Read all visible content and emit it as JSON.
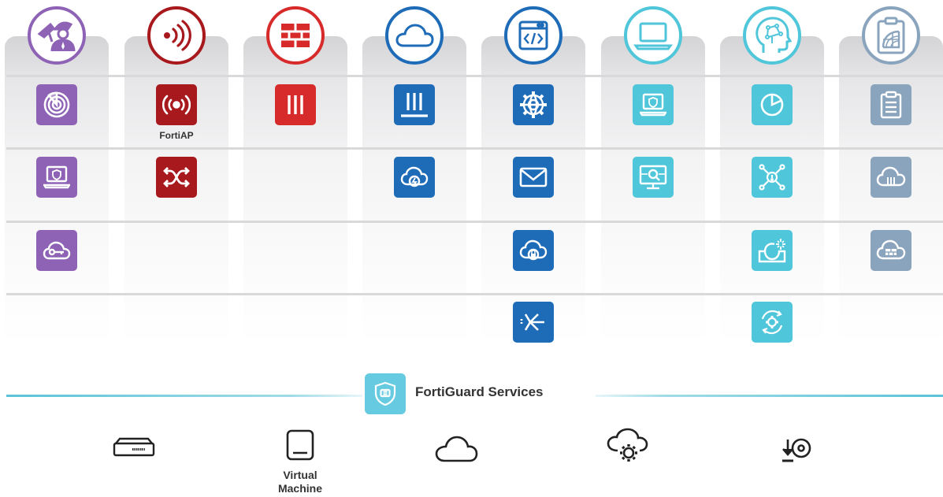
{
  "colors": {
    "purple": "#8e63b5",
    "dark_red": "#a8191e",
    "red": "#d72b2b",
    "blue": "#1e6bb8",
    "teal": "#4fc6d9",
    "gray_blue": "#8aa4bd",
    "fortiguard": "#66cbe0"
  },
  "columns": [
    {
      "header_icon": "security-guard-icon",
      "color": "#8e63b5",
      "tiles": [
        "radar-icon",
        "laptop-shield-icon",
        "key-cloud-icon",
        null
      ]
    },
    {
      "header_icon": "wireless-signal-icon",
      "color": "#a8191e",
      "tiles": [
        "wireless-ap-icon",
        "switch-arrows-icon",
        null,
        null
      ]
    },
    {
      "header_icon": "firewall-brick-icon",
      "color": "#d72b2b",
      "tiles": [
        "firewall-bars-icon",
        null,
        null,
        null
      ]
    },
    {
      "header_icon": "cloud-outline-icon",
      "color": "#1e6bb8",
      "tiles": [
        "appliance-bars-icon",
        "cloud-power-icon",
        null,
        null
      ]
    },
    {
      "header_icon": "code-window-icon",
      "color": "#1e6bb8",
      "tiles": [
        "globe-gear-icon",
        "email-envelope-icon",
        "cloud-lock-icon",
        "arrow-split-icon"
      ]
    },
    {
      "header_icon": "laptop-outline-icon",
      "color": "#4fc6d9",
      "tiles": [
        "laptop-shield-icon",
        "monitor-search-icon",
        null,
        null
      ]
    },
    {
      "header_icon": "ai-head-icon",
      "color": "#4fc6d9",
      "tiles": [
        "pie-chart-icon",
        "network-alert-icon",
        "sandbox-burst-icon",
        "gear-cycle-icon"
      ]
    },
    {
      "header_icon": "clipboard-globe-icon",
      "color": "#8aa4bd",
      "tiles": [
        "clipboard-list-icon",
        "cloud-bars-icon",
        "cloud-firewall-icon",
        null
      ]
    }
  ],
  "tile_labels": {
    "fortiap": "FortiAP"
  },
  "fortiguard": {
    "icon": "shield-fortiguard-icon",
    "label": "FortiGuard Services"
  },
  "bottom_icons": [
    {
      "icon": "appliance-device-icon",
      "label": ""
    },
    {
      "icon": "virtual-machine-icon",
      "label": "Virtual Machine"
    },
    {
      "icon": "cloud-outline-icon",
      "label": ""
    },
    {
      "icon": "cloud-gear-icon",
      "label": ""
    },
    {
      "icon": "download-disc-icon",
      "label": ""
    }
  ],
  "bottom_labels": {
    "vm_line1": "Virtual",
    "vm_line2": "Machine"
  }
}
